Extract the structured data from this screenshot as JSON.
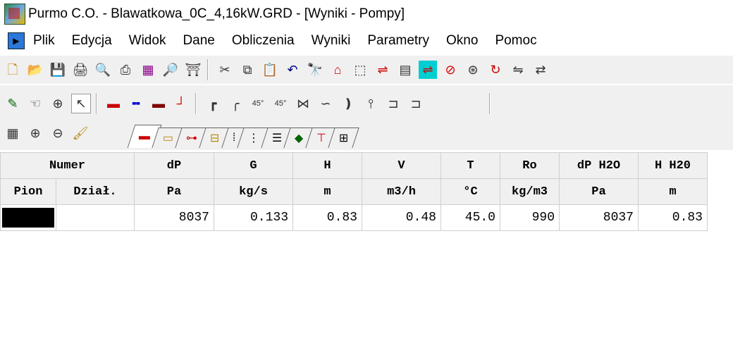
{
  "window": {
    "title": "Purmo C.O.  - Blawatkowa_0C_4,16kW.GRD - [Wyniki - Pompy]"
  },
  "menu": {
    "items": [
      "Plik",
      "Edycja",
      "Widok",
      "Dane",
      "Obliczenia",
      "Wyniki",
      "Parametry",
      "Okno",
      "Pomoc"
    ]
  },
  "toolbar1": {
    "icons": [
      "new-icon",
      "open-icon",
      "save-icon",
      "print-setup-icon",
      "print-preview-icon",
      "print-icon",
      "print-drawing-icon",
      "preview-drawing-icon",
      "export-icon",
      "cut-icon",
      "copy-icon",
      "paste-icon",
      "undo-icon",
      "find-icon",
      "building-icon",
      "frame-icon",
      "pipes-icon",
      "calculator-icon",
      "pipes-active-icon",
      "stop-icon",
      "gauge-icon",
      "refresh-icon",
      "mirror-icon",
      "flip-icon"
    ]
  },
  "toolbar2": {
    "row1": [
      "draw-icon",
      "hand-icon",
      "zoom-in-icon",
      "pointer-icon",
      "pipe-red-icon",
      "pipe-blue-icon",
      "pipe-dark-icon",
      "riser-icon",
      "elbow-90-icon",
      "elbow-icon",
      "elbow-45-icon",
      "elbow-45b-icon",
      "valve-icon",
      "bend-icon",
      "s-bend-icon",
      "radiator-icon",
      "connector-icon",
      "connector-b-icon"
    ],
    "row2": [
      "table-edit-icon",
      "zoom-plus-icon",
      "zoom-minus-icon",
      "brush-icon"
    ],
    "tabs": [
      "tab-pipes-icon",
      "tab-radiator-icon",
      "tab-pump-icon",
      "tab-fitting-icon",
      "tab-box-icon",
      "tab-valves-icon",
      "tab-list-icon",
      "tab-layers-icon",
      "tab-network-icon",
      "tab-plan-icon"
    ]
  },
  "table": {
    "header1": [
      "Numer",
      "dP",
      "G",
      "H",
      "V",
      "T",
      "Ro",
      "dP H2O",
      "H H20"
    ],
    "header2": [
      "Pion",
      "Dział.",
      "Pa",
      "kg/s",
      "m",
      "m3/h",
      "°C",
      "kg/m3",
      "Pa",
      "m"
    ],
    "rows": [
      [
        "",
        "",
        "8037",
        "0.133",
        "0.83",
        "0.48",
        "45.0",
        "990",
        "8037",
        "0.83"
      ]
    ]
  }
}
